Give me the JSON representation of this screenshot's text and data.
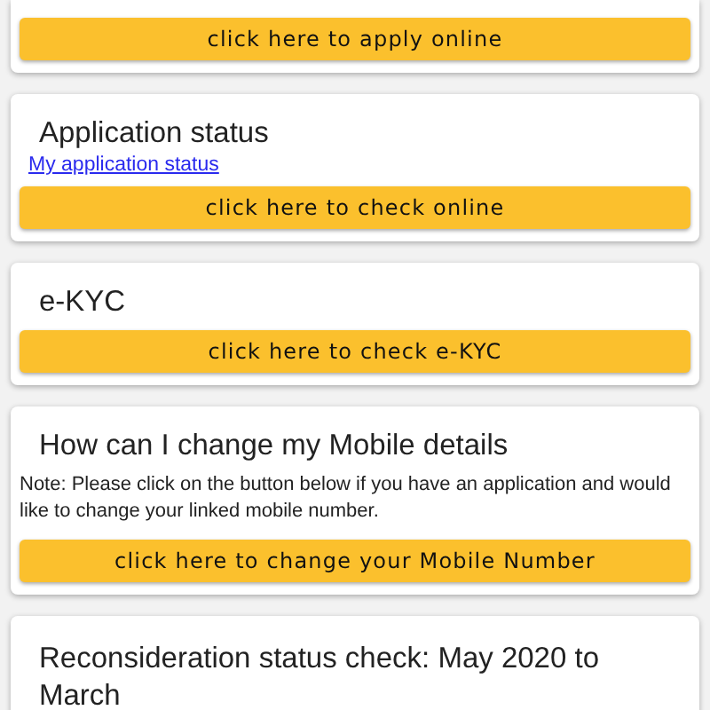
{
  "cards": [
    {
      "button": "click here to apply online"
    },
    {
      "title": "Application status",
      "link": "My application status",
      "button": "click here to check online"
    },
    {
      "title": "e-KYC",
      "button": "click here to check e-KYC"
    },
    {
      "title": "How can I change my Mobile details",
      "note": "Note: Please click on the button below if you have an application and would like to change your linked mobile number.",
      "button": "click here to change your Mobile Number"
    },
    {
      "title": "Reconsideration status check: May 2020 to March"
    }
  ]
}
